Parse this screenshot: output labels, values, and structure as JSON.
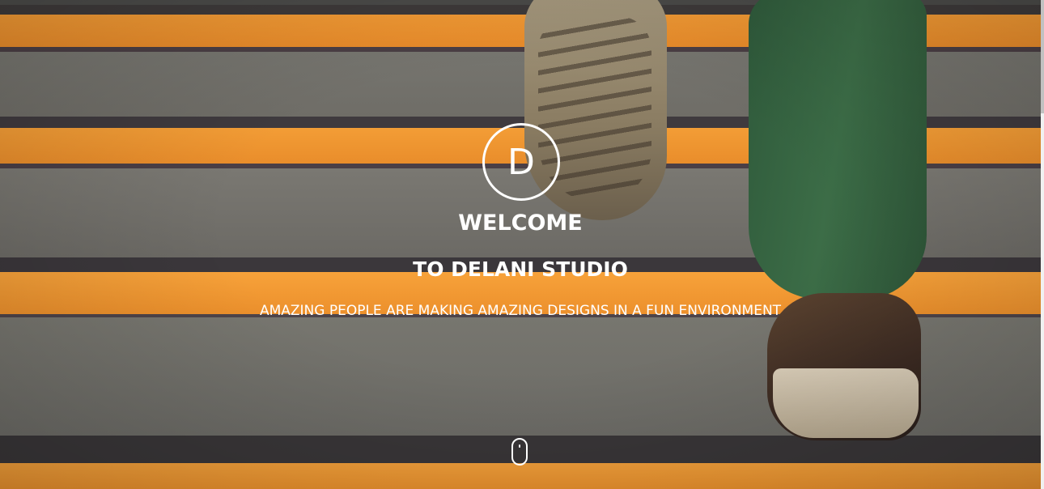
{
  "hero": {
    "logo_letter": "D",
    "welcome": "WELCOME",
    "studio": "TO DELANI STUDIO",
    "tagline": "AMAZING PEOPLE ARE MAKING AMAZING DESIGNS IN A FUN ENVIRONMENT",
    "background_image": "stairs-photo",
    "scroll_icon": "mouse-scroll-icon"
  },
  "colors": {
    "text": "#ffffff",
    "stair_stripe": "#f29a34",
    "stair_concrete": "#77756f"
  }
}
